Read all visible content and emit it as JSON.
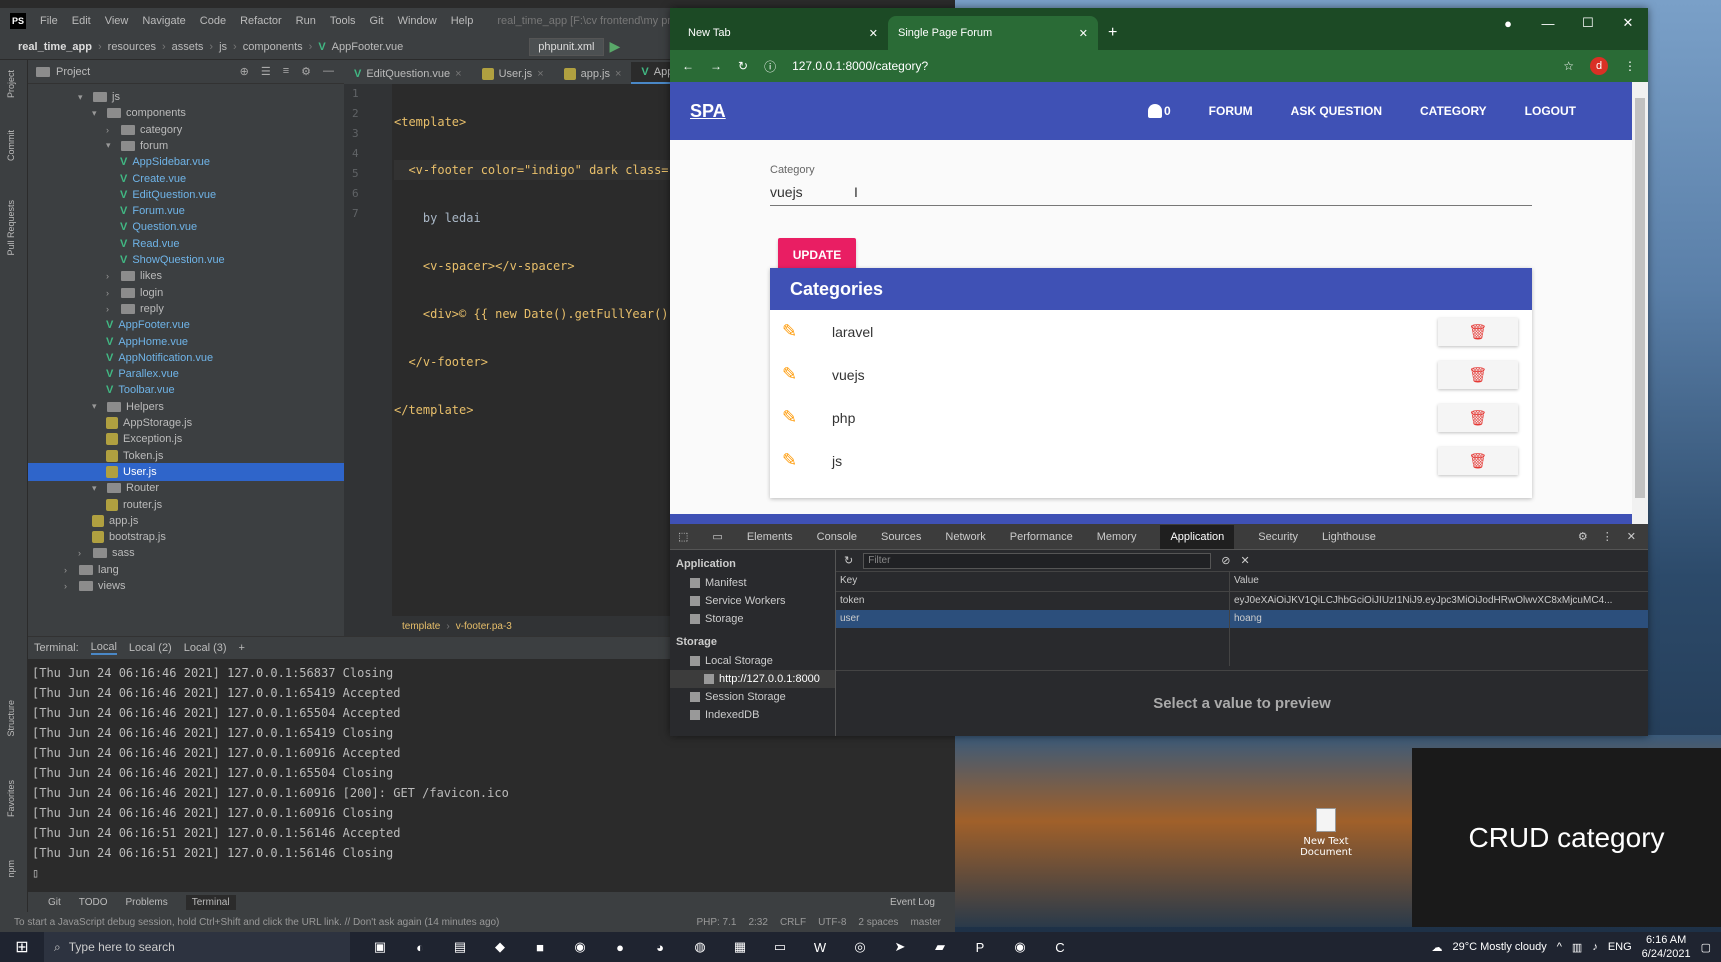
{
  "desktop": {
    "overlay_label": "CRUD category",
    "icon_label": "New Text Document"
  },
  "ide": {
    "menu": [
      "File",
      "Edit",
      "View",
      "Navigate",
      "Code",
      "Refactor",
      "Run",
      "Tools",
      "Git",
      "Window",
      "Help"
    ],
    "window_title": "real_time_app [F:\\cv frontend\\my project\\rea",
    "nav": [
      "real_time_app",
      "resources",
      "assets",
      "js",
      "components",
      "AppFooter.vue"
    ],
    "run_config": "phpunit.xml",
    "project_label": "Project",
    "side_tabs": [
      "Project",
      "Commit",
      "Pull Requests",
      "Structure",
      "Favorites",
      "npm"
    ],
    "tree": [
      {
        "label": "js",
        "depth": 0,
        "kind": "folder",
        "open": true
      },
      {
        "label": "components",
        "depth": 1,
        "kind": "folder",
        "open": true
      },
      {
        "label": "category",
        "depth": 2,
        "kind": "folder",
        "open": false
      },
      {
        "label": "forum",
        "depth": 2,
        "kind": "folder",
        "open": true
      },
      {
        "label": "AppSidebar.vue",
        "depth": 3,
        "kind": "vue"
      },
      {
        "label": "Create.vue",
        "depth": 3,
        "kind": "vue"
      },
      {
        "label": "EditQuestion.vue",
        "depth": 3,
        "kind": "vue"
      },
      {
        "label": "Forum.vue",
        "depth": 3,
        "kind": "vue"
      },
      {
        "label": "Question.vue",
        "depth": 3,
        "kind": "vue"
      },
      {
        "label": "Read.vue",
        "depth": 3,
        "kind": "vue"
      },
      {
        "label": "ShowQuestion.vue",
        "depth": 3,
        "kind": "vue"
      },
      {
        "label": "likes",
        "depth": 2,
        "kind": "folder",
        "open": false
      },
      {
        "label": "login",
        "depth": 2,
        "kind": "folder",
        "open": false
      },
      {
        "label": "reply",
        "depth": 2,
        "kind": "folder",
        "open": false
      },
      {
        "label": "AppFooter.vue",
        "depth": 2,
        "kind": "vue"
      },
      {
        "label": "AppHome.vue",
        "depth": 2,
        "kind": "vue"
      },
      {
        "label": "AppNotification.vue",
        "depth": 2,
        "kind": "vue"
      },
      {
        "label": "Parallex.vue",
        "depth": 2,
        "kind": "vue"
      },
      {
        "label": "Toolbar.vue",
        "depth": 2,
        "kind": "vue"
      },
      {
        "label": "Helpers",
        "depth": 1,
        "kind": "folder",
        "open": true
      },
      {
        "label": "AppStorage.js",
        "depth": 2,
        "kind": "js"
      },
      {
        "label": "Exception.js",
        "depth": 2,
        "kind": "js"
      },
      {
        "label": "Token.js",
        "depth": 2,
        "kind": "js"
      },
      {
        "label": "User.js",
        "depth": 2,
        "kind": "js",
        "selected": true
      },
      {
        "label": "Router",
        "depth": 1,
        "kind": "folder",
        "open": true
      },
      {
        "label": "router.js",
        "depth": 2,
        "kind": "js"
      },
      {
        "label": "app.js",
        "depth": 1,
        "kind": "js"
      },
      {
        "label": "bootstrap.js",
        "depth": 1,
        "kind": "js"
      },
      {
        "label": "sass",
        "depth": 0,
        "kind": "folder",
        "open": false
      },
      {
        "label": "lang",
        "depth": -1,
        "kind": "folder",
        "open": false
      },
      {
        "label": "views",
        "depth": -1,
        "kind": "folder",
        "open": false
      }
    ],
    "editor_tabs": [
      "EditQuestion.vue",
      "User.js",
      "app.js",
      "AppFoot"
    ],
    "line_numbers": [
      "1",
      "2",
      "3",
      "4",
      "5",
      "6",
      "7"
    ],
    "code_lines": [
      "<template>",
      "  <v-footer color=\"indigo\" dark class=",
      "    by ledai",
      "    <v-spacer></v-spacer>",
      "    <div>© {{ new Date().getFullYear()",
      "  </v-footer>",
      "</template>"
    ],
    "breadcrumb": [
      "template",
      "v-footer.pa-3"
    ],
    "terminal_label": "Terminal:",
    "terminal_tabs": [
      "Local",
      "Local (2)",
      "Local (3)"
    ],
    "terminal_lines": [
      "[Thu Jun 24 06:16:46 2021] 127.0.0.1:56837 Closing",
      "[Thu Jun 24 06:16:46 2021] 127.0.0.1:65419 Accepted",
      "[Thu Jun 24 06:16:46 2021] 127.0.0.1:65504 Accepted",
      "[Thu Jun 24 06:16:46 2021] 127.0.0.1:65419 Closing",
      "[Thu Jun 24 06:16:46 2021] 127.0.0.1:60916 Accepted",
      "[Thu Jun 24 06:16:46 2021] 127.0.0.1:65504 Closing",
      "[Thu Jun 24 06:16:46 2021] 127.0.0.1:60916 [200]: GET /favicon.ico",
      "[Thu Jun 24 06:16:46 2021] 127.0.0.1:60916 Closing",
      "[Thu Jun 24 06:16:51 2021] 127.0.0.1:56146 Accepted",
      "[Thu Jun 24 06:16:51 2021] 127.0.0.1:56146 Closing"
    ],
    "bottom_tabs": [
      "Git",
      "TODO",
      "Problems",
      "Terminal"
    ],
    "event_log": "Event Log",
    "status_msg": "To start a JavaScript debug session, hold Ctrl+Shift and click the URL link. // Don't ask again (14 minutes ago)",
    "status_right": [
      "PHP: 7.1",
      "2:32",
      "CRLF",
      "UTF-8",
      "2 spaces",
      "master"
    ]
  },
  "browser": {
    "tabs": [
      "New Tab",
      "Single Page Forum"
    ],
    "url": "127.0.0.1:8000/category?",
    "avatar_letter": "d",
    "app": {
      "brand": "SPA",
      "notif_count": "0",
      "nav": [
        "FORUM",
        "ASK QUESTION",
        "CATEGORY",
        "LOGOUT"
      ],
      "category_label": "Category",
      "category_value": "vuejs",
      "update_label": "UPDATE",
      "card_title": "Categories",
      "categories": [
        "laravel",
        "vuejs",
        "php",
        "js"
      ]
    },
    "devtools": {
      "tabs": [
        "Elements",
        "Console",
        "Sources",
        "Network",
        "Performance",
        "Memory",
        "Application",
        "Security",
        "Lighthouse"
      ],
      "active_tab": "Application",
      "app_section": "Application",
      "app_items": [
        "Manifest",
        "Service Workers",
        "Storage"
      ],
      "storage_section": "Storage",
      "storage_items": [
        "Local Storage",
        "http://127.0.0.1:8000",
        "Session Storage",
        "IndexedDB"
      ],
      "filter_placeholder": "Filter",
      "col_key": "Key",
      "col_value": "Value",
      "rows": [
        {
          "key": "token",
          "value": "eyJ0eXAiOiJKV1QiLCJhbGciOiJIUzI1NiJ9.eyJpc3MiOiJodHRwOlwvXC8xMjcuMC4..."
        },
        {
          "key": "user",
          "value": "hoang"
        }
      ],
      "preview": "Select a value to preview"
    }
  },
  "taskbar": {
    "search_placeholder": "Type here to search",
    "weather": "29°C  Mostly cloudy",
    "lang": "ENG",
    "time": "6:16 AM",
    "date": "6/24/2021"
  }
}
